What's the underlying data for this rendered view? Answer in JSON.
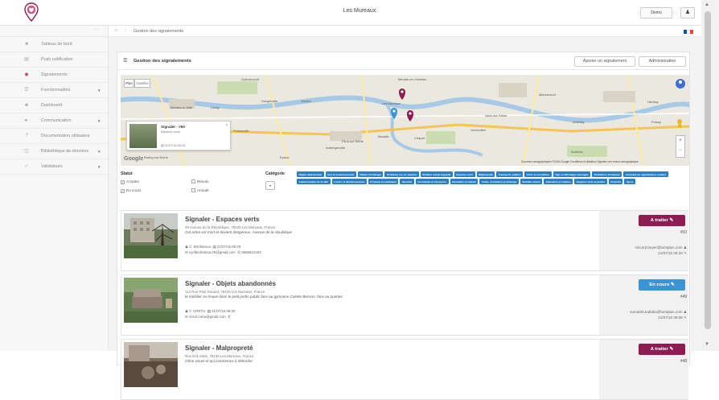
{
  "header": {
    "app_title": "Les Mureaux",
    "user_label": "Demo",
    "user_icon": "user-icon"
  },
  "sidebar": {
    "collapse_label": "···",
    "items": [
      {
        "label": "Tableau de bord",
        "icon": "dashboard-icon"
      },
      {
        "label": "Push notification",
        "icon": "notification-icon"
      },
      {
        "label": "Signalements",
        "icon": "eye-icon"
      },
      {
        "label": "Fonctionnalités",
        "icon": "list-icon",
        "has_children": true
      },
      {
        "label": "Dashboard",
        "icon": "users-icon"
      },
      {
        "label": "Communication",
        "icon": "megaphone-icon",
        "has_children": true
      },
      {
        "label": "Documentation utilisateur",
        "icon": "question-icon"
      },
      {
        "label": "Bibliothèque de données",
        "icon": "database-icon",
        "has_children": true
      },
      {
        "label": "Validateurs",
        "icon": "check-icon",
        "has_children": true
      }
    ]
  },
  "breadcrumb": {
    "label": "Gestion des signalements"
  },
  "panel": {
    "title": "Gestion des signalements",
    "add_button": "Ajouter un signalement",
    "admin_button": "Administration"
  },
  "map": {
    "tabs": [
      "Plan",
      "Satellite"
    ],
    "places": [
      "Guitrancourt",
      "Meulan-en-Yvelines",
      "Gargenville",
      "Juziers",
      "Mantes-la-Jolie",
      "Les Mureaux",
      "Vaux-sur-Seine",
      "Mauvecourt",
      "Herblay",
      "Porcheville",
      "Verneuillet",
      "Andrésy",
      "Rosny-sur-Seine",
      "Aubergenville",
      "Bouafle",
      "Chapet",
      "Achères",
      "Epone",
      "Flins-sur-Seine",
      "Limay",
      "Poissy"
    ],
    "info_title": "Signaler - #50",
    "info_subtitle": "Espaces verts",
    "info_date": "21/07/16 08:25",
    "google_label": "Google",
    "legal_text": "Données cartographiques ©2016 Google   Conditions d'utilisation   Signaler une erreur cartographique"
  },
  "filters": {
    "status_label": "Statut",
    "status_options": [
      {
        "label": "A traiter",
        "checked": true
      },
      {
        "label": "Résolu",
        "checked": false
      },
      {
        "label": "En cours",
        "checked": true
      },
      {
        "label": "Annulé",
        "checked": false
      }
    ],
    "category_label": "Catégorie",
    "category_toggle": "▾",
    "tags": [
      "Objets abandonnés",
      "Eau et assainissement",
      "Défaut d'éclairage",
      "Problème sur un chantier",
      "Mobilier urbain dégradé",
      "Espaces verts",
      "Malpropreté",
      "Transports publics",
      "Voirie et circulation",
      "Tags et affichages sauvages",
      "Problèmes d'animaux",
      "Anomalie de signalisation routière",
      "Administration de la ville",
      "Loisirs et divertissements",
      "Propreté et esthétique",
      "Sécurité",
      "Circulation et transports",
      "Education et culture",
      "Voirie, circulation et éclairage",
      "Mobilier urbain",
      "Education et enfance",
      "Espaces verts et jardins",
      "Propreté",
      "Sport"
    ]
  },
  "reports": [
    {
      "title": "Signaler - Espaces verts",
      "address": "49 Avenue de la République, 78130 Les Mureaux, France",
      "description": "Cet arbre est mort et devient dangereux. Avenue de la république",
      "author": "C. Benhamou",
      "created": "21/07/16 08:29",
      "email": "cyrilbenhamou78@gmail.com",
      "phone": "0668812153",
      "status": "A traiter",
      "status_color": "#8e1c53",
      "number": "#50",
      "assignee_email": "vincent.boyer@lumiplan.com",
      "updated": "21/07/16 08:34"
    },
    {
      "title": "Signaler - Objets abandonnés",
      "address": "114 Rue Paul Douard, 78130 Les Mureaux, France",
      "description": "le mobilier se trouve dans le petit jardin public face au gymnase Colette Besson, face au quartier",
      "author": "V. CRETU",
      "created": "21/07/16 08:25",
      "email": "victor.cretu@gmail.com",
      "phone": "",
      "status": "En cours",
      "status_color": "#3d94d4",
      "number": "#49",
      "assignee_email": "sumanth.katlaba@lumiplan.com",
      "updated": "21/07/16 08:35"
    },
    {
      "title": "Signaler - Malpropreté",
      "address": "Rue Erik Satie, 78130 Les Mureaux, France",
      "description": "Gêne visuel et qui commence à déborder",
      "author": "",
      "created": "",
      "email": "",
      "phone": "",
      "status": "A traiter",
      "status_color": "#8e1c53",
      "number": "#48",
      "assignee_email": "",
      "updated": ""
    }
  ]
}
